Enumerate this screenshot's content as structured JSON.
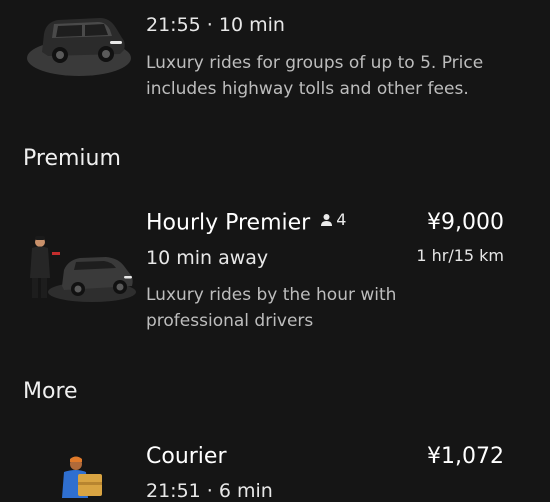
{
  "rides": [
    {
      "time_eta": "21:55 · 10 min",
      "description": "Luxury rides for groups of up to 5. Price includes highway tolls and other fees.",
      "icon": "suv-icon"
    }
  ],
  "sections": {
    "premium_label": "Premium",
    "more_label": "More"
  },
  "hourly_premier": {
    "title": "Hourly Premier",
    "capacity": "4",
    "price": "¥9,000",
    "eta": "10 min away",
    "meta": "1 hr/15 km",
    "description": "Luxury rides by the hour with professional drivers",
    "icon": "chauffeur-car-icon"
  },
  "courier": {
    "title": "Courier",
    "price": "¥1,072",
    "time_eta": "21:51 · 6 min",
    "icon": "courier-icon"
  }
}
